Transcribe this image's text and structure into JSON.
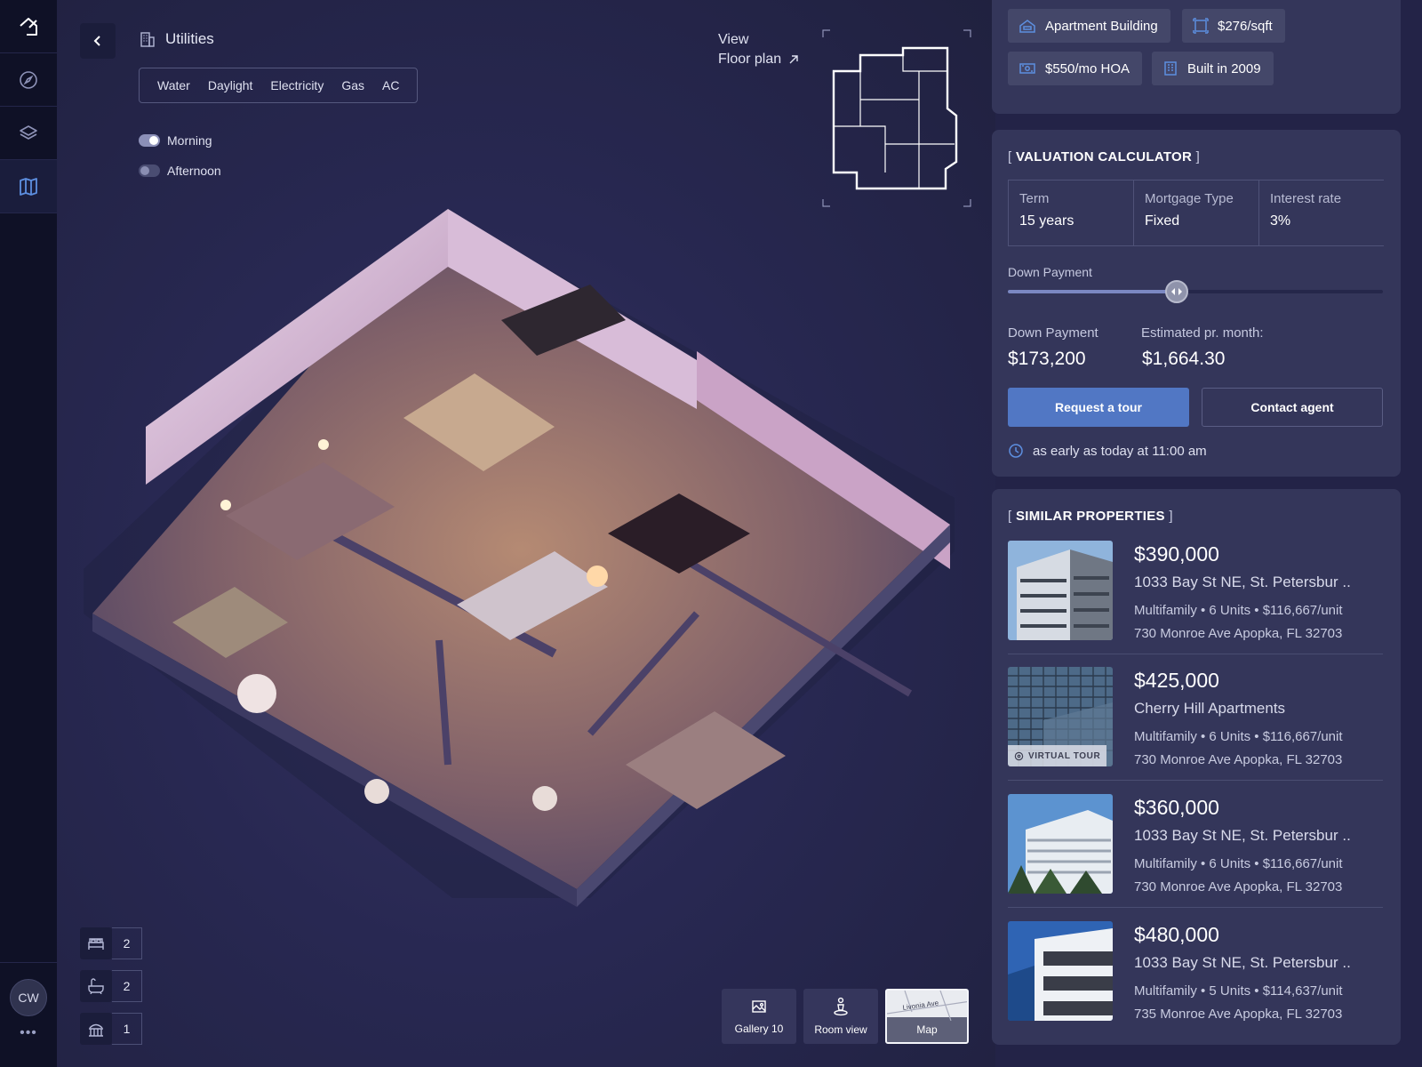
{
  "sidebar": {
    "items": [
      {
        "icon": "home-icon"
      },
      {
        "icon": "compass-icon"
      },
      {
        "icon": "layers-icon"
      },
      {
        "icon": "map-icon",
        "active": true
      }
    ],
    "avatar": "CW",
    "more": "•••"
  },
  "utilities": {
    "title": "Utilities",
    "tabs": [
      "Water",
      "Daylight",
      "Electricity",
      "Gas",
      "AC"
    ],
    "lighting": [
      {
        "label": "Morning",
        "on": true
      },
      {
        "label": "Afternoon",
        "on": false
      }
    ]
  },
  "floorplan": {
    "view_label": "View",
    "link_label": "Floor plan"
  },
  "rooms": {
    "bedrooms": "2",
    "bathrooms": "2",
    "balconies": "1"
  },
  "view_buttons": {
    "gallery": "Gallery 10",
    "room_view": "Room view",
    "map": "Map",
    "map_street": "Livonia Ave"
  },
  "property_tags": {
    "type": "Apartment Building",
    "price_per_sqft": "$276/sqft",
    "hoa": "$550/mo HOA",
    "built": "Built in 2009"
  },
  "valuation": {
    "title": "VALUATION CALCULATOR",
    "term_label": "Term",
    "term_value": "15 years",
    "mortgage_label": "Mortgage Type",
    "mortgage_value": "Fixed",
    "interest_label": "Interest rate",
    "interest_value": "3%",
    "down_payment_slider_label": "Down Payment",
    "down_payment_fraction": 0.45,
    "down_payment_label": "Down Payment",
    "down_payment_value": "$173,200",
    "monthly_label": "Estimated pr. month:",
    "monthly_value": "$1,664.30",
    "request_tour": "Request a tour",
    "contact_agent": "Contact agent",
    "tour_note": "as early as today at 11:00 am"
  },
  "similar": {
    "title": "SIMILAR PROPERTIES",
    "virtual_tour_label": "VIRTUAL TOUR",
    "items": [
      {
        "price": "$390,000",
        "name": "1033 Bay St NE, St. Petersbur ..",
        "meta": "Multifamily • 6 Units • $116,667/unit",
        "address": "730 Monroe Ave Apopka, FL 32703"
      },
      {
        "price": "$425,000",
        "name": "Cherry Hill Apartments",
        "meta": "Multifamily • 6 Units • $116,667/unit",
        "address": "730 Monroe Ave Apopka, FL 32703",
        "virtual_tour": true
      },
      {
        "price": "$360,000",
        "name": "1033 Bay St NE, St. Petersbur ..",
        "meta": "Multifamily • 6 Units • $116,667/unit",
        "address": "730 Monroe Ave Apopka, FL 32703"
      },
      {
        "price": "$480,000",
        "name": "1033 Bay St NE, St. Petersbur ..",
        "meta": "Multifamily • 5 Units • $114,637/unit",
        "address": "735 Monroe Ave Apopka, FL 32703"
      }
    ]
  },
  "colors": {
    "background": "#232347",
    "sidebar": "#0f1126",
    "panel": "#34365a",
    "accent": "#5177c4",
    "icon_accent": "#5d8fe0"
  }
}
